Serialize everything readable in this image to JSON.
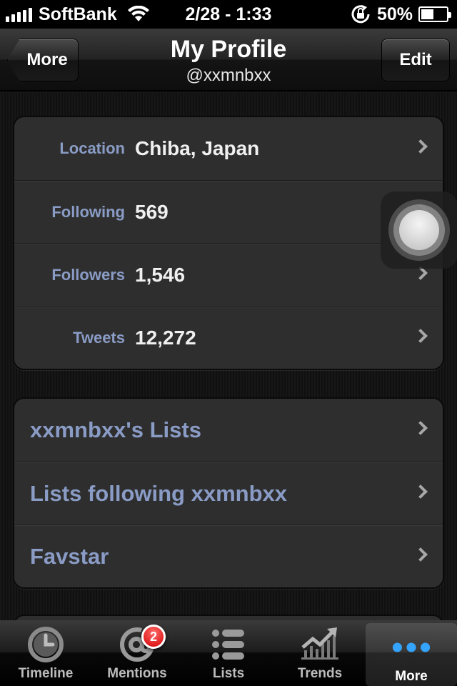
{
  "status_bar": {
    "carrier": "SoftBank",
    "time": "2/28 - 1:33",
    "battery": "50%",
    "battery_level": 0.5
  },
  "nav": {
    "back_label": "More",
    "title": "My Profile",
    "subtitle": "@xxmnbxx",
    "edit_label": "Edit"
  },
  "profile": {
    "rows": [
      {
        "label": "Location",
        "value": "Chiba, Japan"
      },
      {
        "label": "Following",
        "value": "569"
      },
      {
        "label": "Followers",
        "value": "1,546"
      },
      {
        "label": "Tweets",
        "value": "12,272"
      }
    ]
  },
  "links": {
    "items": [
      {
        "label": "xxmnbxx's Lists"
      },
      {
        "label": "Lists following xxmnbxx"
      },
      {
        "label": "Favstar"
      }
    ]
  },
  "tab_bar": {
    "tabs": [
      {
        "label": "Timeline",
        "icon": "clock-icon"
      },
      {
        "label": "Mentions",
        "icon": "at-icon",
        "badge": "2"
      },
      {
        "label": "Lists",
        "icon": "list-icon"
      },
      {
        "label": "Trends",
        "icon": "trends-icon"
      },
      {
        "label": "More",
        "icon": "more-dots-icon",
        "selected": true
      }
    ]
  }
}
